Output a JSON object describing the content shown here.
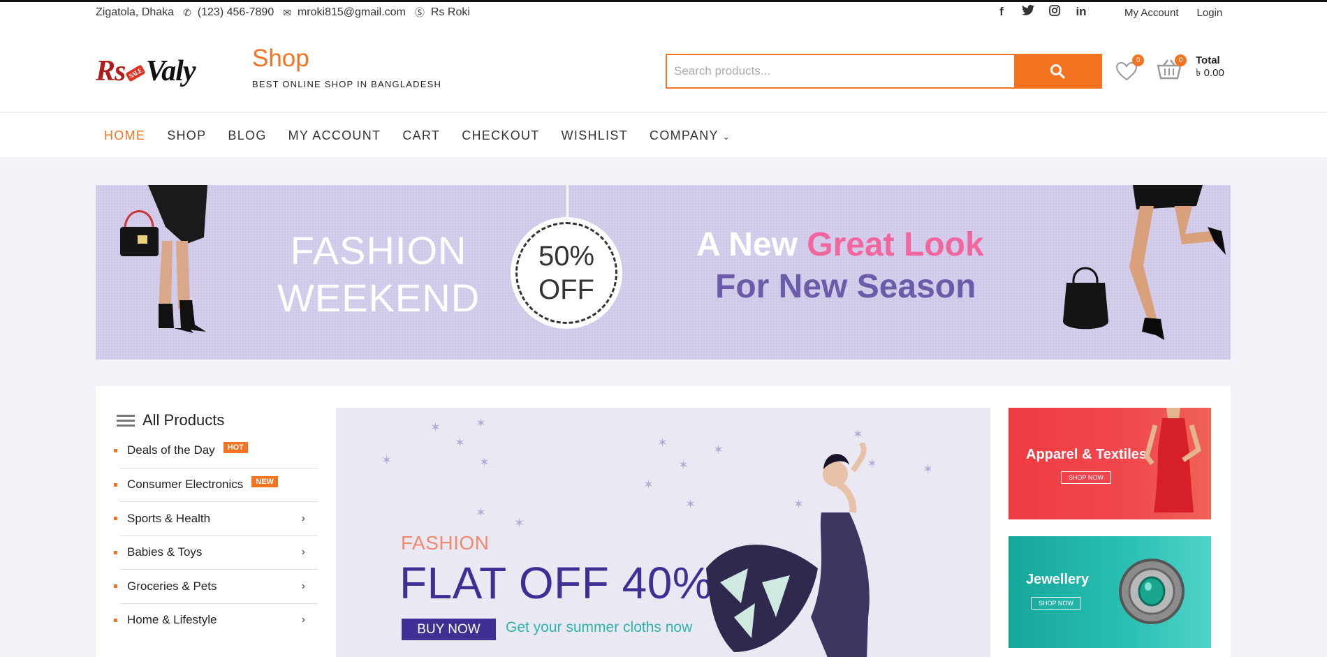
{
  "topbar": {
    "address": "Zigatola, Dhaka",
    "phone": "(123) 456-7890",
    "email": "mroki815@gmail.com",
    "skype": "Rs Roki",
    "social": [
      "f",
      "t",
      "ig",
      "in"
    ],
    "links": {
      "account": "My Account",
      "login": "Login"
    }
  },
  "header": {
    "logo_text": "Rs Valy",
    "logo_tag": "SALE",
    "shop_name": "Shop",
    "tagline": "BEST ONLINE SHOP IN BANGLADESH",
    "search_placeholder": "Search products...",
    "wishlist_count": "0",
    "cart_count": "0",
    "total_label": "Total",
    "total_value": "৳ 0.00"
  },
  "nav": {
    "items": [
      "HOME",
      "SHOP",
      "BLOG",
      "MY ACCOUNT",
      "CART",
      "CHECKOUT",
      "WISHLIST",
      "COMPANY"
    ],
    "active": "HOME"
  },
  "promo": {
    "line_a": "FASHION",
    "line_b": "WEEKEND",
    "discount_a": "50%",
    "discount_b": "OFF",
    "headline_a": "A New ",
    "headline_pink": "Great Look",
    "headline_b": "For New Season"
  },
  "sidebar": {
    "title": "All Products",
    "items": [
      {
        "label": "Deals of the Day",
        "badge": "HOT"
      },
      {
        "label": "Consumer Electronics",
        "badge": "NEW"
      },
      {
        "label": "Sports & Health",
        "arrow": "›"
      },
      {
        "label": "Babies & Toys",
        "arrow": "›"
      },
      {
        "label": "Groceries & Pets",
        "arrow": "›"
      },
      {
        "label": "Home & Lifestyle",
        "arrow": "›"
      }
    ]
  },
  "hero": {
    "kicker": "FASHION",
    "title": "FLAT OFF 40%",
    "button": "BUY NOW",
    "subtitle": "Get your summer cloths now"
  },
  "cards": {
    "apparel": {
      "title": "Apparel & Textiles",
      "button": "SHOP NOW"
    },
    "jewellery": {
      "title": "Jewellery",
      "button": "SHOP NOW"
    }
  },
  "colors": {
    "accent": "#f47321",
    "purple": "#3e2f94",
    "teal": "#2fb5a6"
  }
}
